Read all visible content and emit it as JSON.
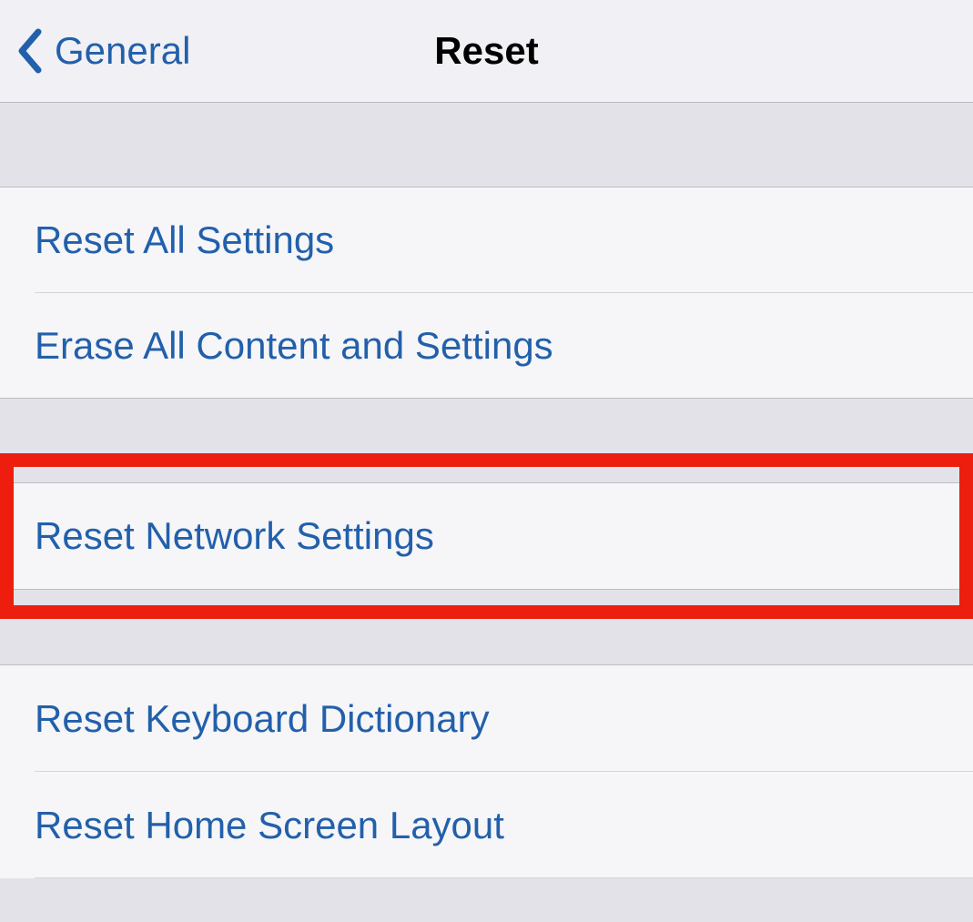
{
  "nav": {
    "back_label": "General",
    "title": "Reset"
  },
  "group1": {
    "items": [
      {
        "label": "Reset All Settings"
      },
      {
        "label": "Erase All Content and Settings"
      }
    ]
  },
  "group2": {
    "items": [
      {
        "label": "Reset Network Settings"
      }
    ]
  },
  "group3": {
    "items": [
      {
        "label": "Reset Keyboard Dictionary"
      },
      {
        "label": "Reset Home Screen Layout"
      }
    ]
  },
  "colors": {
    "link": "#2260ab",
    "highlight": "#ed1e0e",
    "background": "#e3e2e9",
    "cell": "#f6f6f8"
  }
}
